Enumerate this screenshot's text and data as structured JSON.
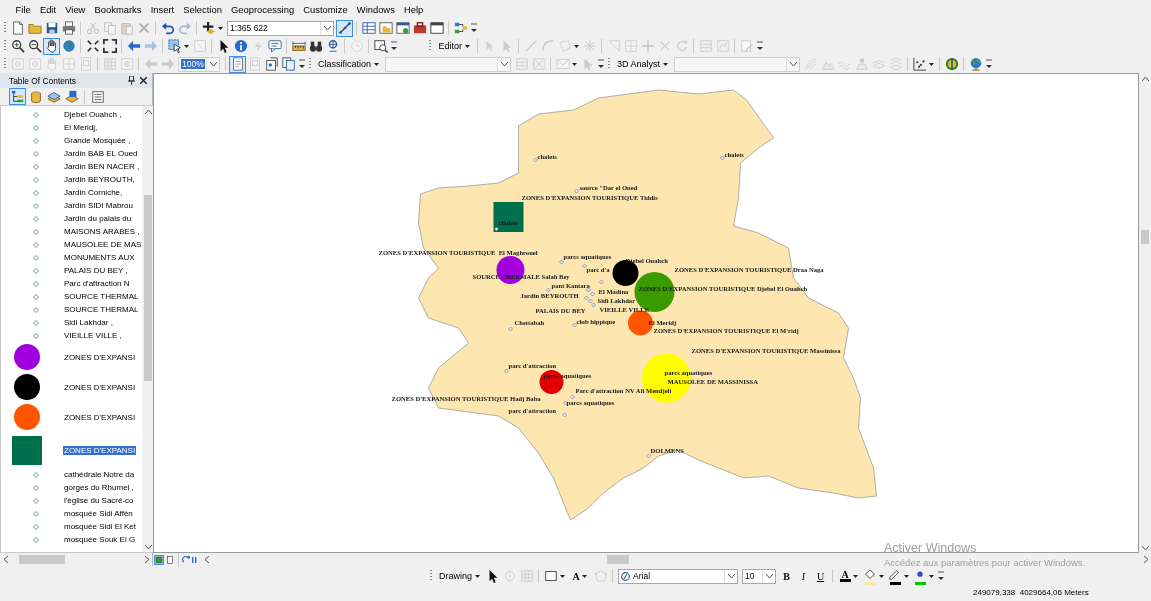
{
  "menu": [
    "File",
    "Edit",
    "View",
    "Bookmarks",
    "Insert",
    "Selection",
    "Geoprocessing",
    "Customize",
    "Windows",
    "Help"
  ],
  "toolbar_rows": [
    [
      {
        "items": [
          {
            "kind": "button",
            "disabled": false,
            "selected": false
          },
          {
            "kind": "button",
            "disabled": false,
            "selected": false
          },
          {
            "kind": "button",
            "disabled": false,
            "selected": false
          },
          {
            "kind": "button",
            "disabled": false,
            "selected": false
          },
          {
            "kind": "separator"
          },
          {
            "kind": "button",
            "disabled": true,
            "selected": false
          },
          {
            "kind": "button",
            "disabled": true,
            "selected": false
          },
          {
            "kind": "button",
            "disabled": true,
            "selected": false
          },
          {
            "kind": "button",
            "disabled": true,
            "selected": false
          },
          {
            "kind": "separator"
          },
          {
            "kind": "button",
            "disabled": false,
            "selected": false
          },
          {
            "kind": "button",
            "disabled": true,
            "selected": false
          },
          {
            "kind": "separator"
          },
          {
            "kind": "split",
            "disabled": false,
            "selected": false
          },
          {
            "kind": "combo",
            "value": "1:365 622",
            "disabled": false,
            "selected": false
          },
          {
            "kind": "button",
            "disabled": false,
            "selected": true
          },
          {
            "kind": "separator"
          },
          {
            "kind": "button",
            "disabled": false,
            "selected": false
          },
          {
            "kind": "button",
            "disabled": false,
            "selected": false
          },
          {
            "kind": "button",
            "disabled": false,
            "selected": false
          },
          {
            "kind": "button",
            "disabled": false,
            "selected": false
          },
          {
            "kind": "button",
            "disabled": false,
            "selected": false
          },
          {
            "kind": "separator"
          },
          {
            "kind": "button",
            "disabled": false,
            "selected": false
          }
        ]
      }
    ],
    [
      {
        "items": [
          {
            "kind": "button",
            "disabled": false,
            "selected": false
          },
          {
            "kind": "button",
            "disabled": false,
            "selected": false
          },
          {
            "kind": "button",
            "disabled": false,
            "selected": true
          },
          {
            "kind": "button",
            "disabled": false,
            "selected": false
          },
          {
            "kind": "separator"
          },
          {
            "kind": "button",
            "disabled": false,
            "selected": false
          },
          {
            "kind": "button",
            "disabled": false,
            "selected": false
          },
          {
            "kind": "separator"
          },
          {
            "kind": "button",
            "disabled": false,
            "selected": false
          },
          {
            "kind": "button",
            "disabled": true,
            "selected": false
          },
          {
            "kind": "separator"
          },
          {
            "kind": "split",
            "disabled": false,
            "selected": false
          },
          {
            "kind": "button",
            "disabled": true,
            "selected": false
          },
          {
            "kind": "separator"
          },
          {
            "kind": "button",
            "disabled": false,
            "selected": false
          },
          {
            "kind": "button",
            "disabled": false,
            "selected": false
          },
          {
            "kind": "button",
            "disabled": true,
            "selected": false
          },
          {
            "kind": "button",
            "disabled": false,
            "selected": false
          },
          {
            "kind": "separator"
          },
          {
            "kind": "button",
            "disabled": false,
            "selected": false
          },
          {
            "kind": "button",
            "disabled": false,
            "selected": false
          },
          {
            "kind": "button",
            "disabled": false,
            "selected": false
          },
          {
            "kind": "separator"
          },
          {
            "kind": "button",
            "disabled": true,
            "selected": false
          },
          {
            "kind": "separator"
          },
          {
            "kind": "button",
            "disabled": false,
            "selected": false
          }
        ]
      },
      {
        "items": [
          {
            "kind": "menu",
            "label": "Editor"
          },
          {
            "kind": "separator"
          },
          {
            "kind": "button",
            "disabled": true,
            "selected": false
          },
          {
            "kind": "button",
            "disabled": true,
            "selected": false
          },
          {
            "kind": "separator"
          },
          {
            "kind": "button",
            "disabled": true,
            "selected": false
          },
          {
            "kind": "button",
            "disabled": true,
            "selected": false
          },
          {
            "kind": "split",
            "disabled": true,
            "selected": false
          },
          {
            "kind": "button",
            "disabled": true,
            "selected": false
          },
          {
            "kind": "separator"
          },
          {
            "kind": "button",
            "disabled": true,
            "selected": false
          },
          {
            "kind": "button",
            "disabled": true,
            "selected": false
          },
          {
            "kind": "button",
            "disabled": true,
            "selected": false
          },
          {
            "kind": "button",
            "disabled": true,
            "selected": false
          },
          {
            "kind": "button",
            "disabled": true,
            "selected": false
          },
          {
            "kind": "separator"
          },
          {
            "kind": "button",
            "disabled": true,
            "selected": false
          },
          {
            "kind": "button",
            "disabled": true,
            "selected": false
          },
          {
            "kind": "separator"
          },
          {
            "kind": "button",
            "disabled": true,
            "selected": false
          }
        ]
      }
    ],
    [
      {
        "items": [
          {
            "kind": "button",
            "disabled": true,
            "selected": false
          },
          {
            "kind": "button",
            "disabled": true,
            "selected": false
          },
          {
            "kind": "button",
            "disabled": true,
            "selected": false
          },
          {
            "kind": "button",
            "disabled": true,
            "selected": false
          },
          {
            "kind": "button",
            "disabled": true,
            "selected": false
          },
          {
            "kind": "separator"
          },
          {
            "kind": "button",
            "disabled": true,
            "selected": false
          },
          {
            "kind": "button",
            "disabled": true,
            "selected": false
          },
          {
            "kind": "separator"
          },
          {
            "kind": "button",
            "disabled": true,
            "selected": false
          },
          {
            "kind": "button",
            "disabled": true,
            "selected": false
          },
          {
            "kind": "combo",
            "value": "100%",
            "disabled": true,
            "selected": true
          },
          {
            "kind": "separator"
          },
          {
            "kind": "button",
            "disabled": false,
            "selected": true
          },
          {
            "kind": "button",
            "disabled": true,
            "selected": false
          },
          {
            "kind": "button",
            "disabled": false,
            "selected": false
          },
          {
            "kind": "button",
            "disabled": false,
            "selected": false
          }
        ]
      },
      {
        "items": [
          {
            "kind": "menu",
            "label": "Classification"
          },
          {
            "kind": "combo",
            "disabled": true
          },
          {
            "kind": "button",
            "disabled": true,
            "selected": false
          },
          {
            "kind": "button",
            "disabled": true,
            "selected": false
          },
          {
            "kind": "separator"
          },
          {
            "kind": "split",
            "disabled": true,
            "selected": false
          },
          {
            "kind": "button",
            "disabled": true,
            "selected": false
          }
        ]
      },
      {
        "items": [
          {
            "kind": "menu",
            "label": "3D Analyst"
          },
          {
            "kind": "combo",
            "disabled": true
          },
          {
            "kind": "button",
            "disabled": true,
            "selected": false
          },
          {
            "kind": "button",
            "disabled": true,
            "selected": false
          },
          {
            "kind": "button",
            "disabled": true,
            "selected": false
          },
          {
            "kind": "button",
            "disabled": true,
            "selected": false
          },
          {
            "kind": "button",
            "disabled": true,
            "selected": false
          },
          {
            "kind": "button",
            "disabled": true,
            "selected": false
          },
          {
            "kind": "separator"
          },
          {
            "kind": "split",
            "disabled": false,
            "selected": false
          },
          {
            "kind": "separator"
          },
          {
            "kind": "button",
            "disabled": false,
            "selected": false
          },
          {
            "kind": "separator"
          },
          {
            "kind": "button",
            "disabled": false,
            "selected": false
          }
        ]
      }
    ]
  ],
  "table_of_contents": {
    "title": "Table Of Contents",
    "tools": [
      {
        "selected": true
      },
      {
        "selected": false
      },
      {
        "selected": false
      },
      {
        "selected": false
      },
      {
        "selected": false
      }
    ],
    "layers": [
      {
        "kind": "point",
        "label": "Djebel Ouahch ,",
        "selected": false
      },
      {
        "kind": "point",
        "label": "El Meridj,",
        "selected": false
      },
      {
        "kind": "point",
        "label": "Grande Mosquée ,",
        "selected": false
      },
      {
        "kind": "point",
        "label": "Jardin BAB EL Oued",
        "selected": false
      },
      {
        "kind": "point",
        "label": "Jardin BEN NACER ,",
        "selected": false
      },
      {
        "kind": "point",
        "label": "Jardin BEYROUTH,",
        "selected": false
      },
      {
        "kind": "point",
        "label": "Jardin Corniche,",
        "selected": false
      },
      {
        "kind": "point",
        "label": "Jardin SIDI Mabrou",
        "selected": false
      },
      {
        "kind": "point",
        "label": "Jardin du palais du",
        "selected": false
      },
      {
        "kind": "point",
        "label": "MAISONS ARABES ,",
        "selected": false
      },
      {
        "kind": "point",
        "label": "MAUSOLEE DE MAS",
        "selected": false
      },
      {
        "kind": "point",
        "label": "MONUMENTS AUX",
        "selected": false
      },
      {
        "kind": "point",
        "label": "PALAIS DU BEY ,",
        "selected": false
      },
      {
        "kind": "point",
        "label": "Parc d'attraction N",
        "selected": false
      },
      {
        "kind": "point",
        "label": "SOURCE THERMAL",
        "selected": false
      },
      {
        "kind": "point",
        "label": "SOURCE THERMAL",
        "selected": false
      },
      {
        "kind": "point",
        "label": "Sidi Lakhdar ,",
        "selected": false
      },
      {
        "kind": "point",
        "label": "VIEILLE VILLE ,",
        "selected": false
      },
      {
        "kind": "circle",
        "color": "#a000e0",
        "label": "ZONES D'EXPANSI",
        "selected": false
      },
      {
        "kind": "circle",
        "color": "#000000",
        "label": "ZONES D'EXPANSI",
        "selected": false
      },
      {
        "kind": "circle",
        "color": "#ff5500",
        "label": "ZONES D'EXPANSI",
        "selected": false
      },
      {
        "kind": "square",
        "color": "#006f4b",
        "label": "ZONES D'EXPANSI",
        "selected": true
      },
      {
        "kind": "point",
        "label": "cathédrale Notre da",
        "selected": false
      },
      {
        "kind": "point",
        "label": "gorges du Rhumel ,",
        "selected": false
      },
      {
        "kind": "point",
        "label": "l'église du Sacré-co",
        "selected": false
      },
      {
        "kind": "point",
        "label": "mosquée Sidi Affèn",
        "selected": false
      },
      {
        "kind": "point",
        "label": "mosquée Sidi El Ket",
        "selected": false
      },
      {
        "kind": "point",
        "label": "mosquée Souk El G",
        "selected": false
      }
    ]
  },
  "map": {
    "markers": [
      {
        "kind": "square",
        "color": "#006f4b"
      },
      {
        "kind": "circle",
        "color": "#a000e0"
      },
      {
        "kind": "circle",
        "color": "#000000"
      },
      {
        "kind": "circle",
        "color": "#3a9a00"
      },
      {
        "kind": "circle",
        "color": "#ff5500"
      },
      {
        "kind": "circle",
        "color": "#ffff00"
      },
      {
        "kind": "circle",
        "color": "#e00000"
      }
    ],
    "labels": [
      "chalets",
      "chalets",
      "source \"Dar el Oued",
      "ZONES D'EXPANSION TOURISTIQUE Tiddis",
      "chalets",
      "ZONES D'EXPANSION TOURISTIQUE  El Maghrouel",
      "parcs aquatiques",
      "Djebel Ouahch",
      "parc d'a",
      "ZONES D'EXPANSION TOURISTIQUE Draa Naga",
      "SOURCE THERMALE Salah Bey",
      "pont Kantara",
      "ZONES D'EXPANSION TOURISTIQUE Djebel El Ouahch",
      "El Madina",
      "Jardin BEYROUTH",
      "Sidi Lakhdar",
      "PALAIS DU BEY",
      "VIEILLE VILLE",
      "Chettabah",
      "club hippique",
      "El Meridj",
      "ZONES D'EXPANSION TOURISTIQUE El M'ridj",
      "ZONES D'EXPANSION TOURISTIQUE Massinissa",
      "parc d'attraction",
      "parcs aquatiques",
      "parcs aquatiques",
      "MAUSOLEE DE MASSINISSA",
      "Parc d'attraction NV Ali Mendjeli",
      "ZONES D'EXPANSION TOURISTIQUE Hadj Baba",
      "parcs aquatiques",
      "parc d'attraction",
      "DOLMENS"
    ]
  },
  "view_buttons": [
    {
      "selected": true
    },
    {
      "selected": false
    }
  ],
  "drawing_toolbar": {
    "items": [
      {
        "kind": "menu",
        "label": "Drawing"
      },
      {
        "kind": "button",
        "disabled": false,
        "selected": false
      },
      {
        "kind": "button",
        "disabled": true,
        "selected": false
      },
      {
        "kind": "button",
        "disabled": true,
        "selected": false
      },
      {
        "kind": "separator"
      },
      {
        "kind": "split",
        "disabled": false,
        "selected": false
      },
      {
        "kind": "textsplit",
        "label": "A",
        "disabled": false,
        "selected": false
      },
      {
        "kind": "button",
        "disabled": true,
        "selected": false
      },
      {
        "kind": "separator"
      },
      {
        "kind": "fontcombo",
        "value": "Arial",
        "disabled": false,
        "selected": false
      },
      {
        "kind": "combo",
        "value": "10",
        "disabled": false,
        "selected": false
      },
      {
        "kind": "text",
        "label": "B",
        "disabled": false,
        "selected": false
      },
      {
        "kind": "text",
        "label": "I",
        "disabled": false,
        "selected": false
      },
      {
        "kind": "text",
        "label": "U",
        "disabled": false,
        "selected": false
      },
      {
        "kind": "separator"
      },
      {
        "kind": "textsplit",
        "label": "A",
        "color": "#000000",
        "disabled": false,
        "selected": false
      },
      {
        "kind": "split",
        "color": "#f4ec9a",
        "disabled": false,
        "selected": false
      },
      {
        "kind": "split",
        "color": "#000000",
        "disabled": false,
        "selected": false
      },
      {
        "kind": "split",
        "color": "#00c800",
        "disabled": false,
        "selected": false
      }
    ]
  },
  "windows_notice": {
    "title": "Activer Windows",
    "message": "Accédez aux paramètres pour activer Windows."
  },
  "status_bar": {
    "coordinates": "249079,338  4029664,06 Meters"
  }
}
